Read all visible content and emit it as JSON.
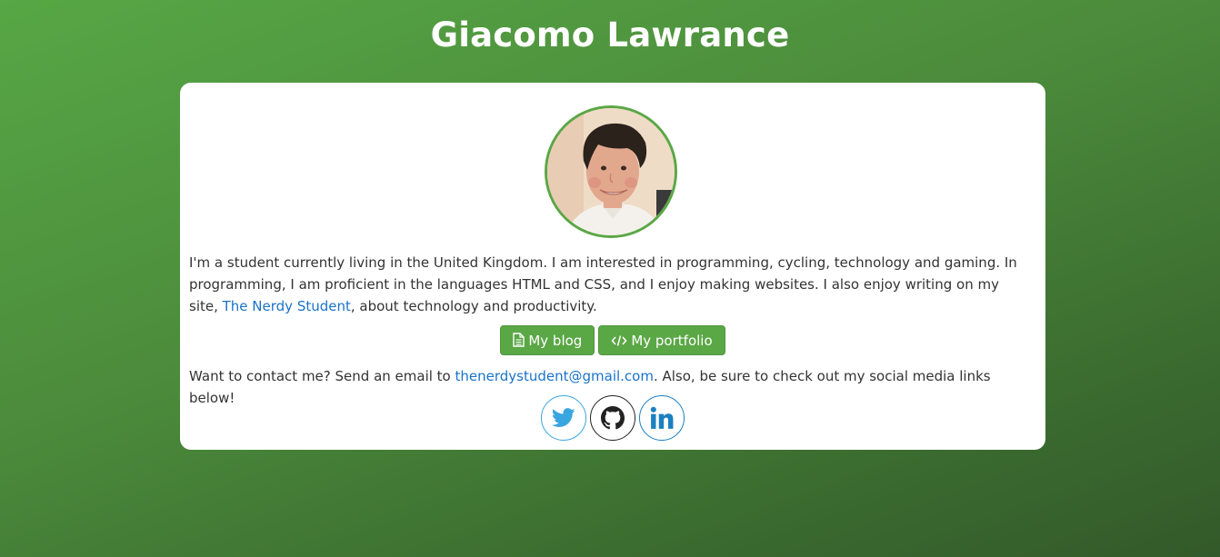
{
  "header": {
    "title": "Giacomo Lawrance"
  },
  "profile": {
    "avatar_icon": "profile-photo",
    "bio_text_1": "I'm a student currently living in the United Kingdom. I am interested in programming, cycling, technology and gaming. In programming, I am proficient in the languages HTML and CSS, and I enjoy making websites. I also enjoy writing on my site, ",
    "bio_link": "The Nerdy Student",
    "bio_text_2": ", about technology and productivity."
  },
  "buttons": {
    "blog_label": "My blog",
    "blog_icon": "document-icon",
    "portfolio_label": "My portfolio",
    "portfolio_icon": "code-icon"
  },
  "contact": {
    "text_1": "Want to contact me? Send an email to ",
    "email": "thenerdystudent@gmail.com",
    "text_2": ". Also, be sure to check out my social media links below!"
  },
  "socials": [
    {
      "name": "twitter",
      "icon": "twitter-icon",
      "color": "#3aa6e0"
    },
    {
      "name": "github",
      "icon": "github-icon",
      "color": "#222222"
    },
    {
      "name": "linkedin",
      "icon": "linkedin-icon",
      "color": "#1b80c0"
    }
  ],
  "colors": {
    "accent": "#5aa746",
    "link": "#1a73c9",
    "card_background": "#ffffff"
  }
}
